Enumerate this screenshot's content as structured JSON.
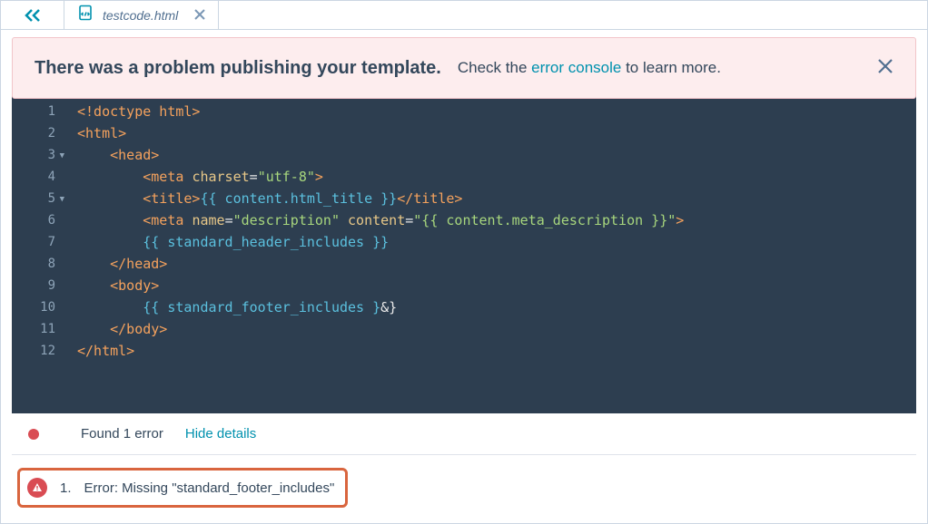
{
  "tab": {
    "filename": "testcode.html"
  },
  "alert": {
    "title": "There was a problem publishing your template.",
    "text_before": "Check the ",
    "link": "error console",
    "text_after": " to learn more."
  },
  "code": {
    "lines": [
      {
        "n": "1"
      },
      {
        "n": "2"
      },
      {
        "n": "3"
      },
      {
        "n": "4"
      },
      {
        "n": "5"
      },
      {
        "n": "6"
      },
      {
        "n": "7"
      },
      {
        "n": "8"
      },
      {
        "n": "9"
      },
      {
        "n": "10"
      },
      {
        "n": "11"
      },
      {
        "n": "12"
      }
    ],
    "tokens": {
      "l1_doctype": "<!doctype html>",
      "l2_open": "<html>",
      "l3_open": "<head>",
      "l4_meta_open": "<meta",
      "l4_attr_charset": "charset",
      "l4_eq": "=",
      "l4_val": "\"utf-8\"",
      "l4_close": ">",
      "l5_title_open": "<title>",
      "l5_var": "{{ content.html_title }}",
      "l5_title_close": "</title>",
      "l6_meta_open": "<meta",
      "l6_attr_name": "name",
      "l6_val_name": "\"description\"",
      "l6_attr_content": "content",
      "l6_val_content": "\"{{ content.meta_description }}\"",
      "l6_close": ">",
      "l7_var": "{{ standard_header_includes }}",
      "l8_close": "</head>",
      "l9_open": "<body>",
      "l10_var": "{{ standard_footer_includes }",
      "l10_tail": "&}",
      "l11_close": "</body>",
      "l12_close": "</html>"
    }
  },
  "errors": {
    "summary": "Found 1 error",
    "hide": "Hide details",
    "items": [
      {
        "num": "1.",
        "msg": "Error:  Missing \"standard_footer_includes\""
      }
    ]
  }
}
